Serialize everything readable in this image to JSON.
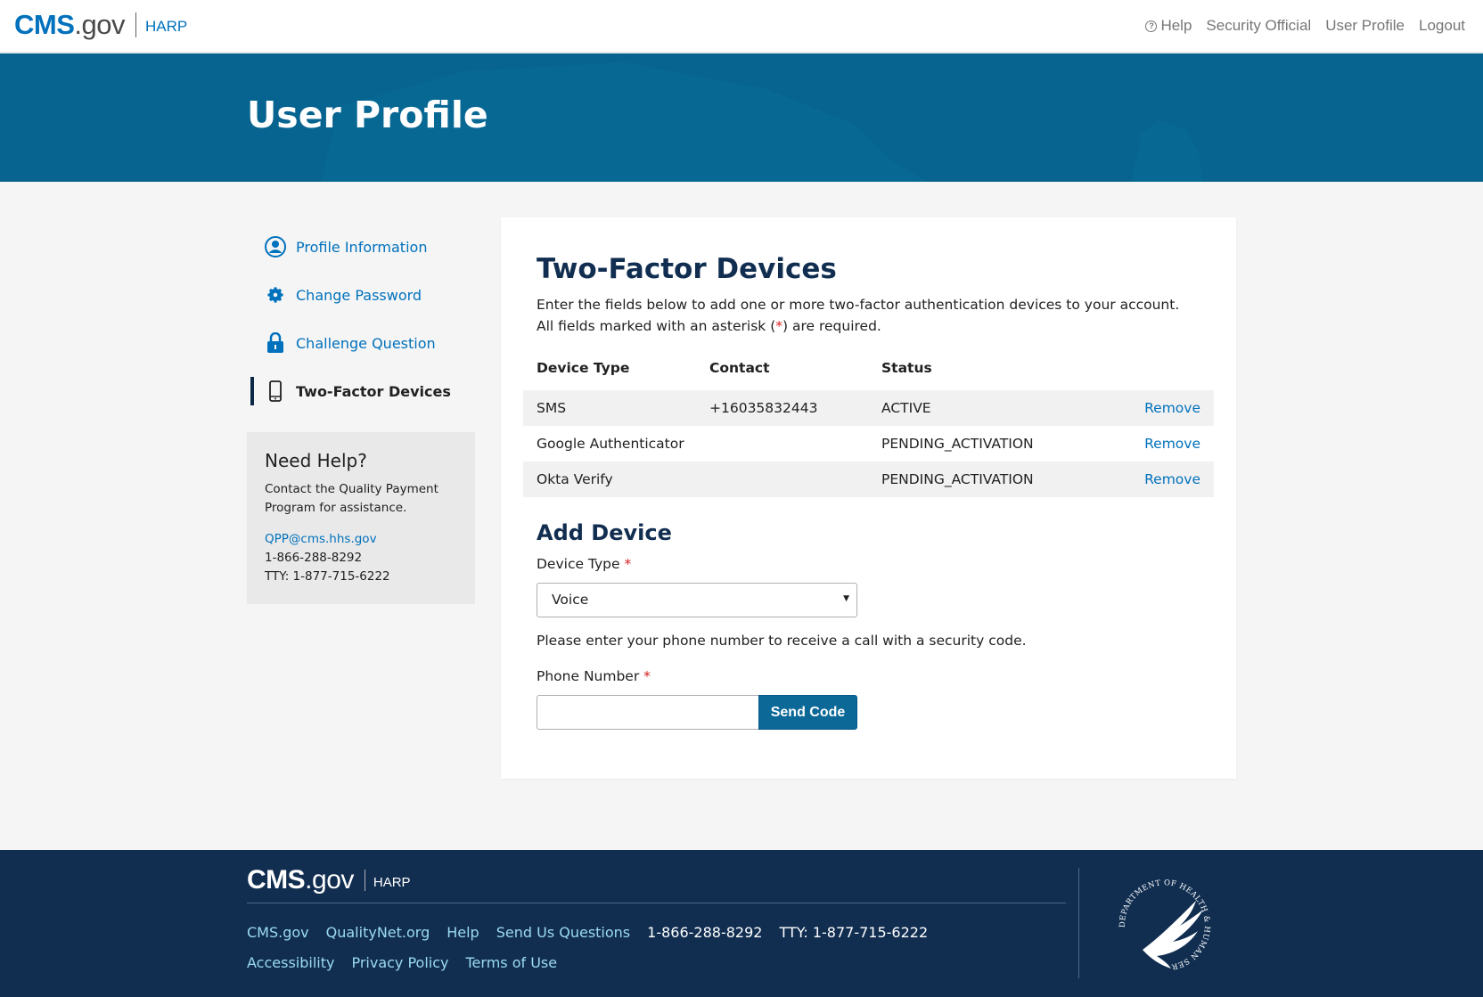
{
  "header": {
    "logo_cms": "CMS",
    "logo_gov": ".gov",
    "logo_harp": "HARP",
    "nav": [
      {
        "label": "Help",
        "icon": "help-circle-icon"
      },
      {
        "label": "Security Official"
      },
      {
        "label": "User Profile"
      },
      {
        "label": "Logout"
      }
    ]
  },
  "hero": {
    "title": "User Profile"
  },
  "sidebar": {
    "items": [
      {
        "label": "Profile Information",
        "icon": "user-circle-icon"
      },
      {
        "label": "Change Password",
        "icon": "gear-icon"
      },
      {
        "label": "Challenge Question",
        "icon": "lock-icon"
      },
      {
        "label": "Two-Factor Devices",
        "icon": "mobile-phone-icon",
        "active": true
      }
    ]
  },
  "help": {
    "title": "Need Help?",
    "text": "Contact the Quality Payment Program for assistance.",
    "email": "QPP@cms.hhs.gov",
    "phone": "1-866-288-8292",
    "tty": "TTY: 1-877-715-6222"
  },
  "main": {
    "title": "Two-Factor Devices",
    "intro_line1": "Enter the fields below to add one or more two-factor authentication devices to your account.",
    "intro_line2_pre": "All fields marked with an asterisk (",
    "asterisk": "*",
    "intro_line2_post": ") are required.",
    "table": {
      "headers": [
        "Device Type",
        "Contact",
        "Status"
      ],
      "rows": [
        {
          "type": "SMS",
          "contact": "+16035832443",
          "status": "ACTIVE",
          "action": "Remove"
        },
        {
          "type": "Google Authenticator",
          "contact": "",
          "status": "PENDING_ACTIVATION",
          "action": "Remove"
        },
        {
          "type": "Okta Verify",
          "contact": "",
          "status": "PENDING_ACTIVATION",
          "action": "Remove"
        }
      ]
    },
    "add_device": {
      "title": "Add Device",
      "device_type_label": "Device Type",
      "device_type_value": "Voice",
      "hint": "Please enter your phone number to receive a call with a security code.",
      "phone_label": "Phone Number",
      "phone_value": "",
      "send_button": "Send Code"
    }
  },
  "footer": {
    "logo_cms": "CMS",
    "logo_gov": ".gov",
    "logo_harp": "HARP",
    "links_row1": [
      "CMS.gov",
      "QualityNet.org",
      "Help",
      "Send Us Questions"
    ],
    "phone": "1-866-288-8292",
    "tty": "TTY: 1-877-715-6222",
    "links_row2": [
      "Accessibility",
      "Privacy Policy",
      "Terms of Use"
    ],
    "seal_text": "DEPARTMENT OF HEALTH & HUMAN SERVICES · USA"
  },
  "colors": {
    "brand_blue": "#0071bc",
    "hero_bg": "#07638f",
    "footer_bg": "#112e51",
    "footer_link": "#9bdaf1",
    "required": "#d51e1e"
  }
}
